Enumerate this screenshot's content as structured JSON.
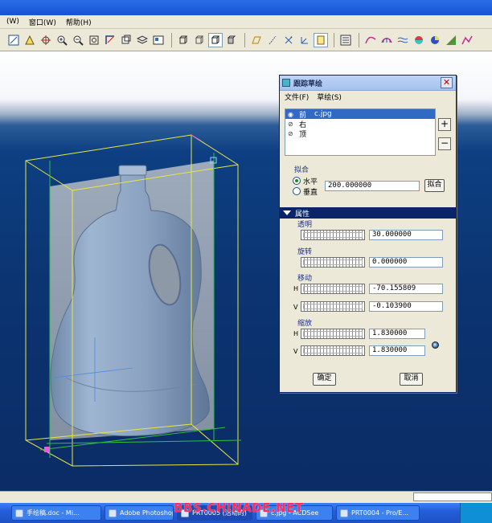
{
  "menubar": {
    "items": [
      "(W)",
      "窗口(W)",
      "帮助(H)"
    ]
  },
  "dialog": {
    "title": "跟踪草绘",
    "close_glyph": "✕",
    "menu": [
      "文件(F)",
      "草绘(S)"
    ],
    "list": [
      {
        "label": "前",
        "file": "c.jpg",
        "selected": true
      },
      {
        "label": "右",
        "file": "",
        "selected": false
      },
      {
        "label": "顶",
        "file": "",
        "selected": false
      }
    ],
    "add_glyph": "+",
    "remove_glyph": "−",
    "fit": {
      "label": "拟合",
      "horizontal": "水平",
      "vertical": "垂直",
      "selected": "horizontal",
      "value": "200.000000",
      "button": "拟合"
    },
    "properties_label": "属性",
    "transparency": {
      "label": "透明",
      "value": "30.000000"
    },
    "rotation": {
      "label": "旋转",
      "value": "0.000000"
    },
    "move": {
      "label": "移动",
      "h_label": "H",
      "v_label": "V",
      "h_value": "-70.155809",
      "v_value": "-0.103900"
    },
    "scale": {
      "label": "缩放",
      "h_label": "H",
      "v_label": "V",
      "h_value": "1.830000",
      "v_value": "1.830000"
    },
    "ok": "确定",
    "cancel": "取消"
  },
  "taskbar": {
    "items": [
      {
        "label": "手绘稿.doc - Mi...",
        "active": false
      },
      {
        "label": "Adobe Photoshop",
        "active": false
      },
      {
        "label": "PRT0005 (活动的)",
        "active": true
      },
      {
        "label": "c.jpg - ACDSee",
        "active": false
      },
      {
        "label": "PRT0004 - Pro/E...",
        "active": false
      }
    ],
    "watermark": "BBS.CHINADE.NET"
  },
  "colors": {
    "canvas_top": "#0d3f82",
    "frame_yellow": "#e8e840",
    "frame_green": "#2ec040",
    "bottle_fill": "#8fa7c4",
    "selection": "#316ac5"
  }
}
